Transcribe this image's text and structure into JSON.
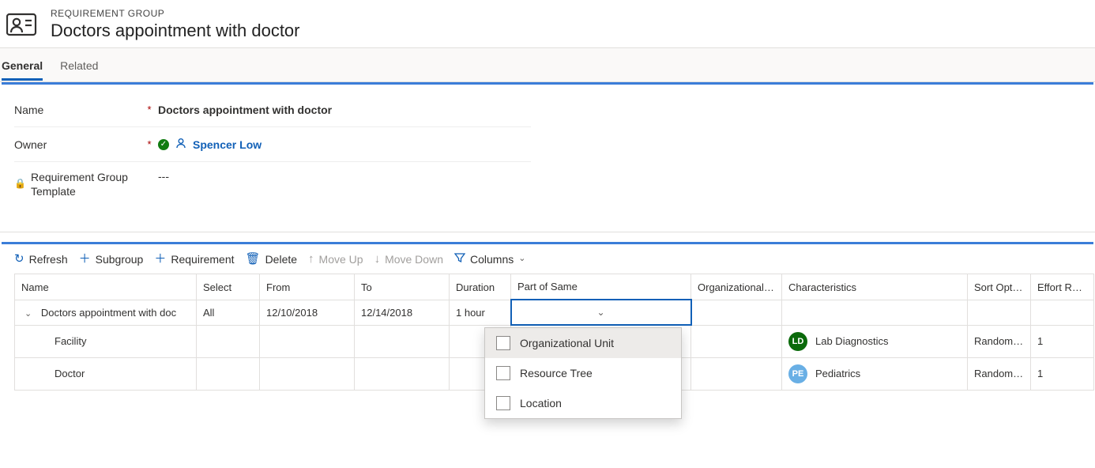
{
  "header": {
    "label": "REQUIREMENT GROUP",
    "title": "Doctors appointment with doctor"
  },
  "tabs": {
    "general": "General",
    "related": "Related"
  },
  "form": {
    "name_label": "Name",
    "name_value": "Doctors appointment with doctor",
    "owner_label": "Owner",
    "owner_value": "Spencer Low",
    "template_label": "Requirement Group Template",
    "template_value": "---"
  },
  "commands": {
    "refresh": "Refresh",
    "subgroup": "Subgroup",
    "requirement": "Requirement",
    "delete": "Delete",
    "moveup": "Move Up",
    "movedown": "Move Down",
    "columns": "Columns"
  },
  "columns": {
    "name": "Name",
    "select": "Select",
    "from": "From",
    "to": "To",
    "duration": "Duration",
    "part_of_same": "Part of Same",
    "org_unit": "Organizational Unit",
    "characteristics": "Characteristics",
    "sort_option": "Sort Option",
    "effort": "Effort Require"
  },
  "rows": {
    "root": {
      "name": "Doctors appointment with doc",
      "select": "All",
      "from": "12/10/2018",
      "to": "12/14/2018",
      "duration": "1 hour"
    },
    "r1": {
      "name": "Facility",
      "char_initials": "LD",
      "char_label": "Lab Diagnostics",
      "sort": "Randomize",
      "effort": "1"
    },
    "r2": {
      "name": "Doctor",
      "char_initials": "PE",
      "char_label": "Pediatrics",
      "sort": "Randomize",
      "effort": "1"
    }
  },
  "dropdown": {
    "opt1": "Organizational Unit",
    "opt2": "Resource Tree",
    "opt3": "Location"
  }
}
